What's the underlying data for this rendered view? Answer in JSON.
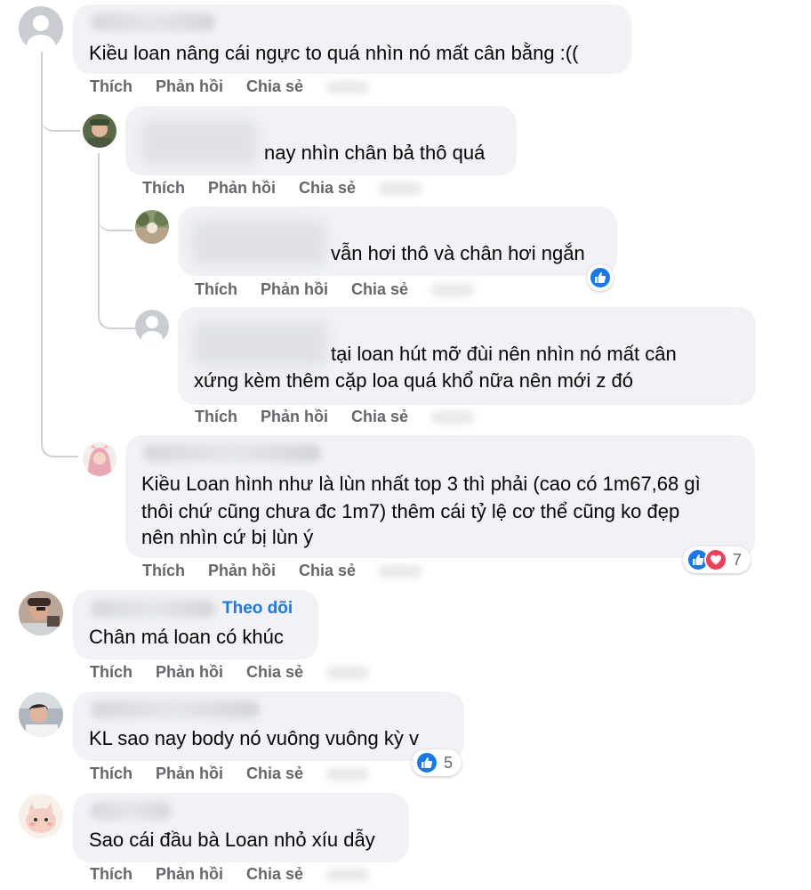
{
  "actions": {
    "like": "Thích",
    "reply": "Phản hồi",
    "share": "Chia sẻ"
  },
  "comments": [
    {
      "text": "Kiều loan nâng cái ngực to quá nhìn nó mất cân bằng :(("
    },
    {
      "text": "nay nhìn chân bả thô quá"
    },
    {
      "text": "vẫn hơi thô và chân hơi ngắn"
    },
    {
      "text_line1": "tại loan hút mỡ đùi nên nhìn nó mất cân",
      "text_line2": "xứng kèm thêm cặp loa quá khổ nữa nên mới z đó"
    },
    {
      "text_line1": "Kiều Loan hình như là lùn nhất top 3 thì phải (cao có 1m67,68 gì",
      "text_line2": "thôi chứ cũng chưa đc 1m7) thêm cái tỷ lệ cơ thể cũng ko đẹp",
      "text_line3": "nên nhìn cứ bị lùn ý",
      "reaction_count": "7"
    },
    {
      "follow": "Theo dõi",
      "text": "Chân má loan có khúc"
    },
    {
      "text": "KL sao nay body nó vuông vuông kỳ v",
      "reaction_count": "5"
    },
    {
      "text": "Sao cái đầu bà Loan nhỏ xíu dẫy"
    }
  ],
  "colors": {
    "bubble": "#f0f2f5",
    "action_text": "#65676b",
    "link": "#1877f2",
    "like": "#1877f2",
    "love": "#f33e58"
  }
}
